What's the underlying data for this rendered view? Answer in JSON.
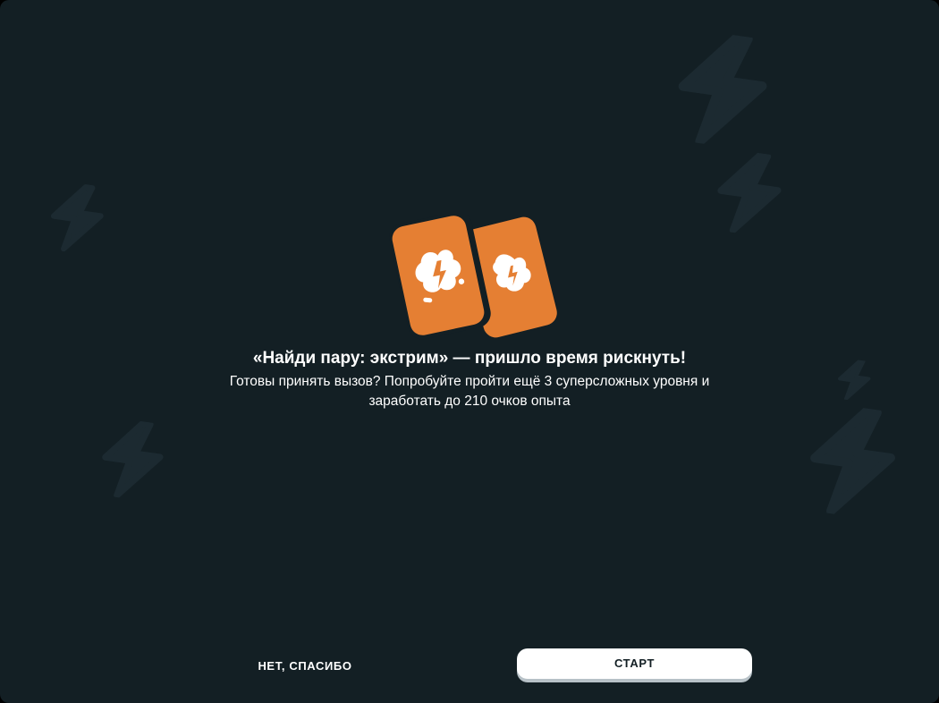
{
  "colors": {
    "background": "#131F24",
    "decor_bolt": "#1C2A31",
    "card_orange": "#E57F33",
    "text": "#FFFFFF",
    "button_bg": "#FFFFFF",
    "button_shadow": "#B7C1C7"
  },
  "hero": {
    "icon": "orange-cards-with-lightning-icon"
  },
  "dialog": {
    "title": "«Найди пару: экстрим» — пришло время рискнуть!",
    "subtitle": "Готовы принять вызов? Попробуйте пройти ещё 3 суперсложных уровня и заработать до 210 очков опыта"
  },
  "buttons": {
    "no_thanks": "НЕТ, СПАСИБО",
    "start": "СТАРТ"
  },
  "decor": {
    "icon": "lightning-bolt-icon"
  }
}
